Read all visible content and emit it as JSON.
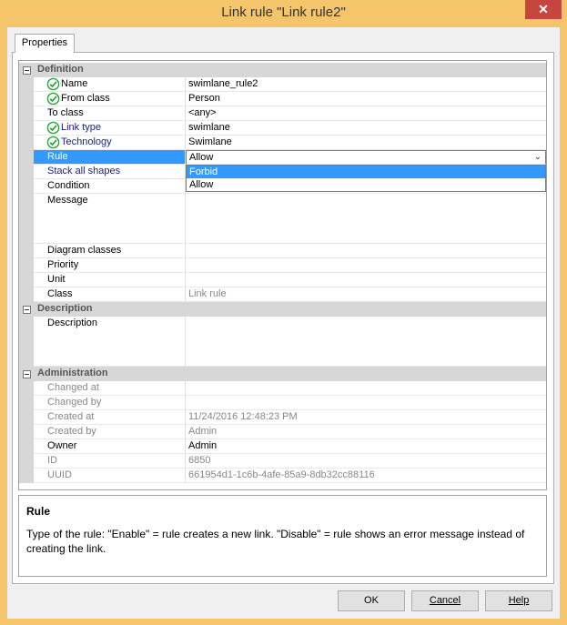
{
  "window": {
    "title": "Link rule \"Link rule2\"",
    "close_glyph": "✕"
  },
  "tabs": [
    {
      "label": "Properties"
    }
  ],
  "sections": {
    "definition": "Definition",
    "description": "Description",
    "administration": "Administration"
  },
  "props": {
    "name": {
      "label": "Name",
      "value": "swimlane_rule2"
    },
    "from_class": {
      "label": "From class",
      "value": "Person"
    },
    "to_class": {
      "label": "To class",
      "value": "<any>"
    },
    "link_type": {
      "label": "Link type",
      "value": "swimlane"
    },
    "technology": {
      "label": "Technology",
      "value": "Swimlane"
    },
    "rule": {
      "label": "Rule",
      "value": "Allow"
    },
    "stack_all_shapes": {
      "label": "Stack all shapes",
      "value": ""
    },
    "condition": {
      "label": "Condition",
      "value": ""
    },
    "message": {
      "label": "Message",
      "value": ""
    },
    "diagram_classes": {
      "label": "Diagram classes",
      "value": ""
    },
    "priority": {
      "label": "Priority",
      "value": ""
    },
    "unit": {
      "label": "Unit",
      "value": ""
    },
    "class": {
      "label": "Class",
      "value": "Link rule"
    },
    "description": {
      "label": "Description",
      "value": ""
    },
    "changed_at": {
      "label": "Changed at",
      "value": ""
    },
    "changed_by": {
      "label": "Changed by",
      "value": ""
    },
    "created_at": {
      "label": "Created at",
      "value": "11/24/2016 12:48:23 PM"
    },
    "created_by": {
      "label": "Created by",
      "value": "Admin"
    },
    "owner": {
      "label": "Owner",
      "value": "Admin"
    },
    "id": {
      "label": "ID",
      "value": "6850"
    },
    "uuid": {
      "label": "UUID",
      "value": "661954d1-1c6b-4afe-85a9-8db32cc88116"
    }
  },
  "rule_dropdown": {
    "options": [
      "Forbid",
      "Allow"
    ],
    "highlighted": "Forbid",
    "arrow": "⌄"
  },
  "help_panel": {
    "title": "Rule",
    "text": "Type of the rule: \"Enable\" = rule creates a new link. \"Disable\" = rule shows an error message instead of creating the link."
  },
  "buttons": {
    "ok": "OK",
    "cancel": "Cancel",
    "help": "Help"
  },
  "colors": {
    "accent": "#3399ff",
    "titlebar": "#f4c56a",
    "close": "#c7453f",
    "valid_check": "#2e9e3e",
    "link_label": "#1a1a9e"
  },
  "icons": {
    "valid": "check-circle-icon",
    "collapse": "minus-box-icon"
  }
}
